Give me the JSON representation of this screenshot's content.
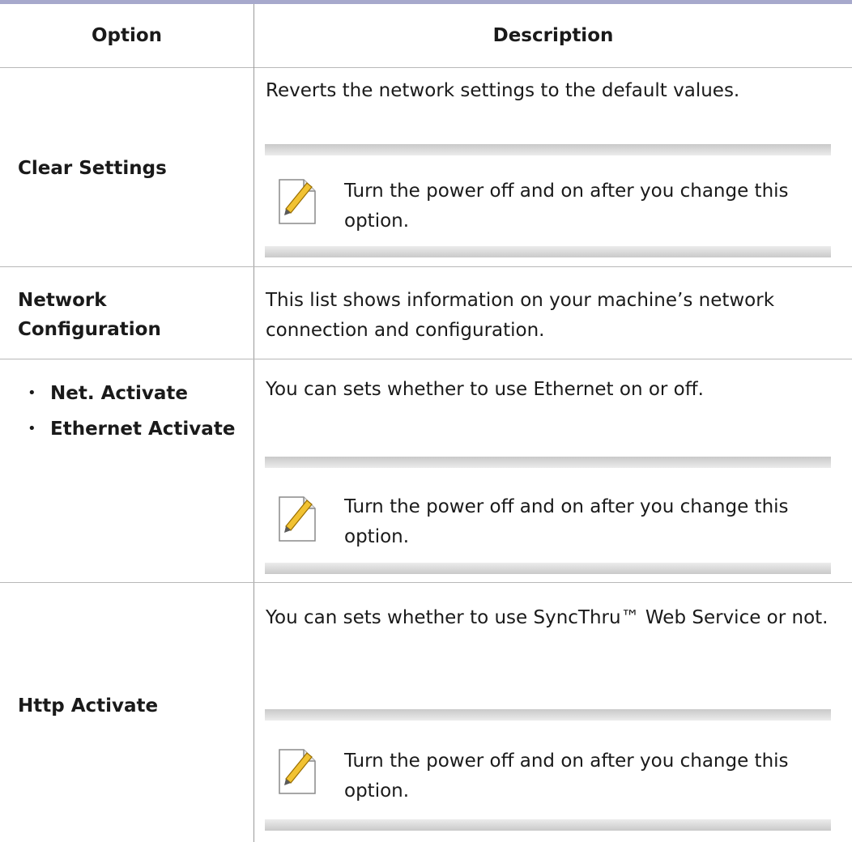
{
  "table": {
    "header": {
      "option": "Option",
      "description": "Description"
    },
    "rows": [
      {
        "option": "Clear Settings",
        "description": "Reverts the network settings to the default values.",
        "note": "Turn the power off and on after you change this option."
      },
      {
        "option_line1": "Network",
        "option_line2": "Configuration",
        "description": "This list shows information on your machine’s network connection and configuration."
      },
      {
        "bullets": [
          "Net. Activate",
          "Ethernet Activate"
        ],
        "description": "You can sets whether to use Ethernet on or off.",
        "note": "Turn the power off and on after you change this option."
      },
      {
        "option": "Http Activate",
        "description": "You can sets whether to use SyncThru™ Web Service or not.",
        "note": "Turn the power off and on after you change this option."
      }
    ]
  },
  "icons": {
    "note": "note-pencil-icon"
  },
  "colors": {
    "top_rule": "#a7a9cc",
    "pencil": "#f1c232"
  }
}
